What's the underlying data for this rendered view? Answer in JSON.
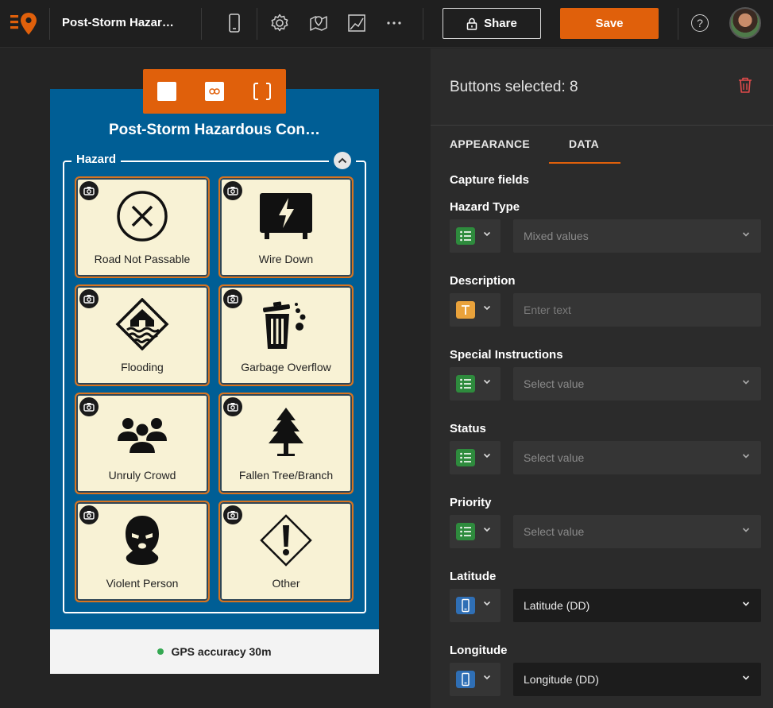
{
  "app": {
    "title": "Post-Storm Hazar…",
    "share_label": "Share",
    "save_label": "Save",
    "help_label": "?",
    "brand_color": "#e0600b"
  },
  "form": {
    "title": "Post-Storm Hazardous Con…",
    "group_label": "Hazard",
    "tiles": [
      {
        "label": "Road Not Passable",
        "icon": "no-entry-icon"
      },
      {
        "label": "Wire Down",
        "icon": "power-box-icon"
      },
      {
        "label": "Flooding",
        "icon": "flood-icon"
      },
      {
        "label": "Garbage Overflow",
        "icon": "trash-icon"
      },
      {
        "label": "Unruly Crowd",
        "icon": "crowd-icon"
      },
      {
        "label": "Fallen Tree/Branch",
        "icon": "tree-icon"
      },
      {
        "label": "Violent Person",
        "icon": "masked-person-icon"
      },
      {
        "label": "Other",
        "icon": "warning-diamond-icon"
      }
    ],
    "footer_text": "GPS accuracy 30m"
  },
  "panel": {
    "selection_text": "Buttons selected: 8",
    "tabs": [
      "APPEARANCE",
      "DATA"
    ],
    "active_tab": "DATA",
    "section_title": "Capture fields",
    "fields": [
      {
        "label": "Hazard Type",
        "type_icon": "list-icon",
        "value": "Mixed values",
        "style": "dim"
      },
      {
        "label": "Description",
        "type_icon": "text-icon",
        "value": "Enter text",
        "style": "dim"
      },
      {
        "label": "Special Instructions",
        "type_icon": "list-icon",
        "value": "Select value",
        "style": "dim"
      },
      {
        "label": "Status",
        "type_icon": "list-icon",
        "value": "Select value",
        "style": "dim"
      },
      {
        "label": "Priority",
        "type_icon": "list-icon",
        "value": "Select value",
        "style": "dim"
      },
      {
        "label": "Latitude",
        "type_icon": "device-icon",
        "value": "Latitude (DD)",
        "style": "dark"
      },
      {
        "label": "Longitude",
        "type_icon": "device-icon",
        "value": "Longitude (DD)",
        "style": "dark"
      }
    ]
  }
}
